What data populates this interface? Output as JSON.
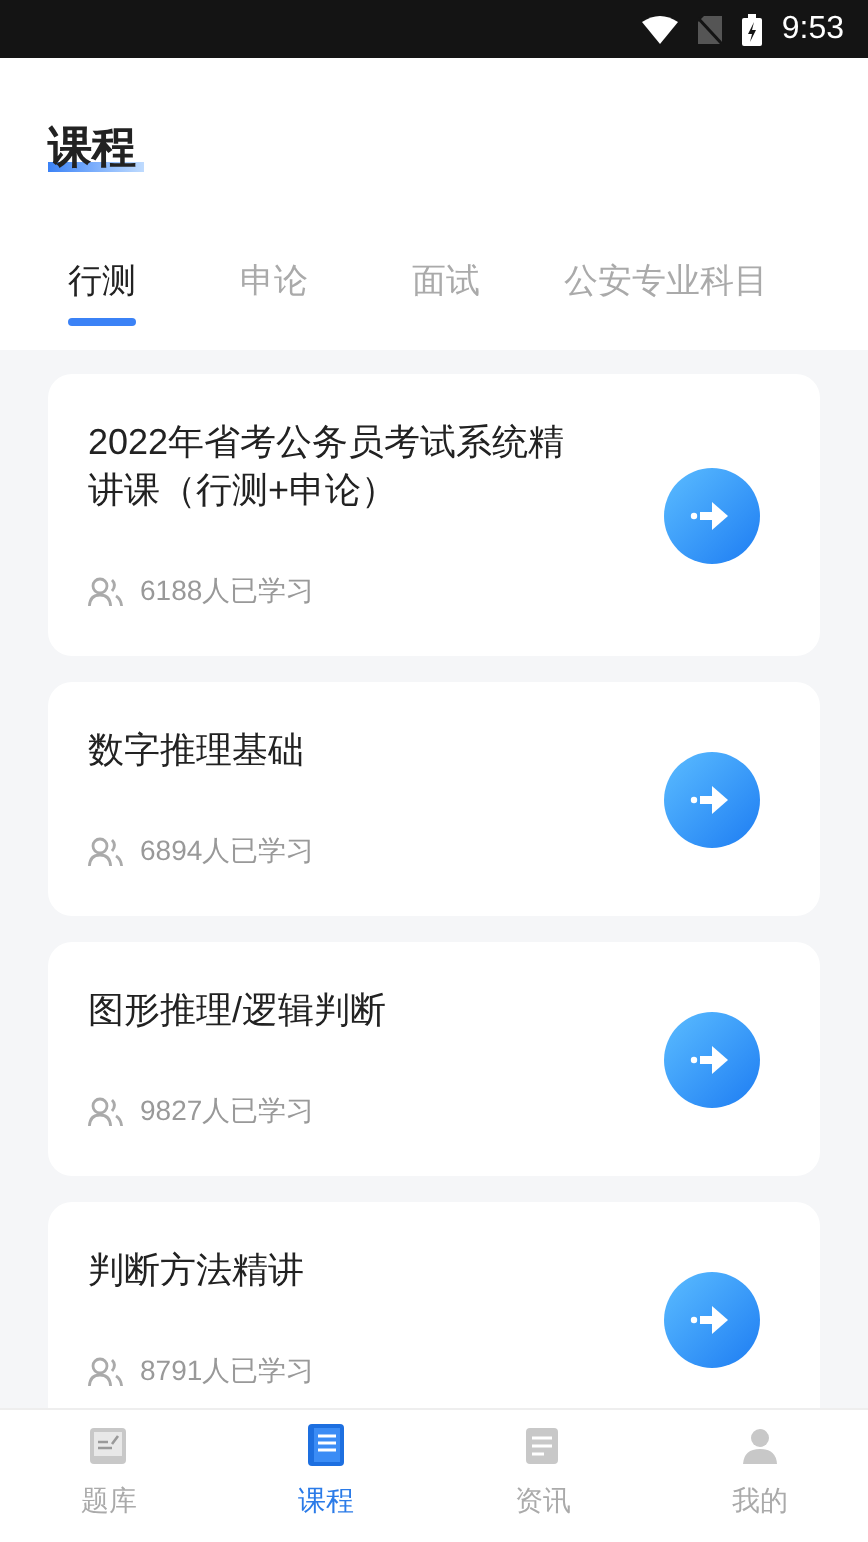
{
  "status_bar": {
    "time": "9:53"
  },
  "header": {
    "title": "课程"
  },
  "tabs": [
    {
      "label": "行测",
      "selected": true
    },
    {
      "label": "申论",
      "selected": false
    },
    {
      "label": "面试",
      "selected": false
    },
    {
      "label": "公安专业科目",
      "selected": false
    }
  ],
  "courses": [
    {
      "title": "2022年省考公务员考试系统精讲课（行测+申论）",
      "learners": "6188人已学习"
    },
    {
      "title": "数字推理基础",
      "learners": "6894人已学习"
    },
    {
      "title": "图形推理/逻辑判断",
      "learners": "9827人已学习"
    },
    {
      "title": "判断方法精讲",
      "learners": "8791人已学习"
    }
  ],
  "bottom_nav": [
    {
      "label": "题库",
      "kind": "bank",
      "selected": false
    },
    {
      "label": "课程",
      "kind": "course",
      "selected": true
    },
    {
      "label": "资讯",
      "kind": "news",
      "selected": false
    },
    {
      "label": "我的",
      "kind": "profile",
      "selected": false
    }
  ]
}
